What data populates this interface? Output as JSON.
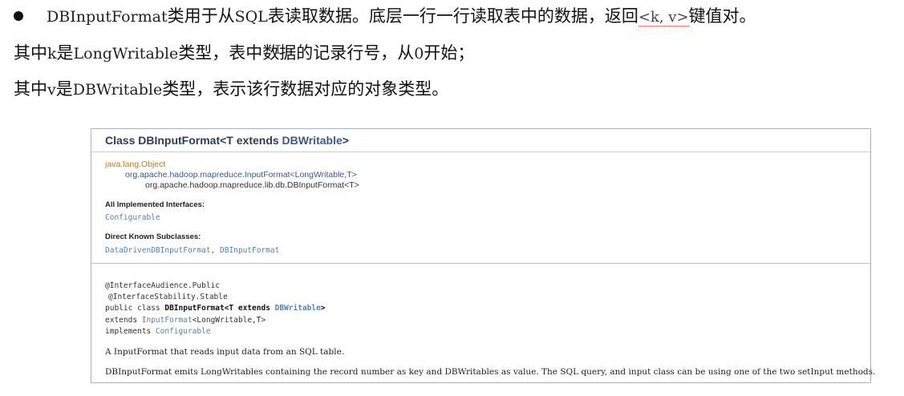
{
  "notes": {
    "line1": {
      "p1": "DBInputFormat",
      "p2": "类用于从",
      "p3": "SQL",
      "p4": "表读取数据。底层一行一行读取表中的数据，返回",
      "p5": "<k, v>",
      "p6": "键值对。"
    },
    "line2": {
      "p1": "其中",
      "p2": "k",
      "p3": "是",
      "p4": "LongWritable",
      "p5": "类型，表中数据的记录行号，从",
      "p6": "0",
      "p7": "开始；"
    },
    "line3": {
      "p1": "其中",
      "p2": "v",
      "p3": "是",
      "p4": "DBWritable",
      "p5": "类型，表示该行数据对应的对象类型。"
    }
  },
  "doc": {
    "title_prefix": "Class DBInputFormat<T extends ",
    "title_link": "DBWritable",
    "title_suffix": ">",
    "hierarchy": [
      "java.lang.Object",
      "org.apache.hadoop.mapreduce.InputFormat<LongWritable,T>",
      "org.apache.hadoop.mapreduce.lib.db.DBInputFormat<T>"
    ],
    "interfaces_label": "All Implemented Interfaces:",
    "interfaces_value": "Configurable",
    "subclasses_label": "Direct Known Subclasses:",
    "subclasses_value": "DataDrivenDBInputFormat, DBInputFormat",
    "signature": {
      "a1": "@InterfaceAudience.Public",
      "a2": "@InterfaceStability.Stable",
      "decl_prefix": "public class ",
      "decl_name": "DBInputFormat<T extends ",
      "decl_link": "DBWritable",
      "decl_suffix": ">",
      "extends_kw": "extends ",
      "extends_link": "InputFormat",
      "extends_rest": "<LongWritable,T>",
      "implements_kw": "implements ",
      "implements_link": "Configurable"
    },
    "desc1": "A InputFormat that reads input data from an SQL table.",
    "desc2": "DBInputFormat emits LongWritables containing the record number as key and DBWritables as value. The SQL query, and input class can be using one of the two setInput methods."
  },
  "colors": {
    "link": "#5a7fa8",
    "object_link": "#c07a10",
    "panel_border": "#aab4c4"
  }
}
